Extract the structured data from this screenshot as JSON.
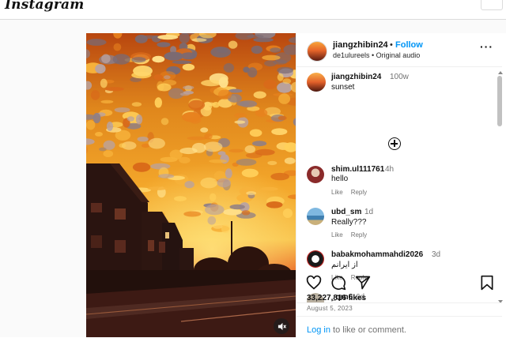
{
  "app": {
    "logo": "Instagram"
  },
  "post": {
    "username": "jiangzhibin24",
    "dot": "•",
    "follow_label": "Follow",
    "audio": "de1ulureels • Original audio",
    "caption": {
      "username": "jiangzhibin24",
      "time": "100w",
      "text": "sunset"
    },
    "likes": "33,227,816 likes",
    "date": "August 5, 2023"
  },
  "comments": [
    {
      "username": "shim.ul111761",
      "time": "4h",
      "text": "hello",
      "like": "Like",
      "reply": "Reply",
      "avatar_color": "#8a2a2a"
    },
    {
      "username": "ubd_sm",
      "time": "1d",
      "text": "Really???",
      "like": "Like",
      "reply": "Reply",
      "avatar_color": "#3f7fb0"
    },
    {
      "username": "babakmohammahdi2026",
      "time": "3d",
      "text": "از ایرانم",
      "like": "Like",
      "reply": "Reply",
      "avatar_color": "#b3211f"
    },
    {
      "username": "_qrn6",
      "time": "6d",
      "text": "",
      "like": "",
      "reply": "",
      "avatar_color": "#b9b0a0"
    }
  ],
  "login": {
    "link": "Log in",
    "rest": " to like or comment."
  },
  "icons": {
    "more": "more-options-icon",
    "add_comment": "plus-circle-icon",
    "like": "heart-icon",
    "comment": "comment-icon",
    "share": "share-icon",
    "save": "bookmark-icon",
    "mute": "speaker-muted-icon"
  },
  "colors": {
    "accent": "#0095f6",
    "muted_text": "#737373"
  }
}
